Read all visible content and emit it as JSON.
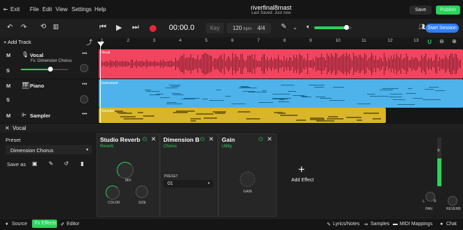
{
  "menubar": {
    "exit": "Exit",
    "file": "File",
    "edit": "Edit",
    "view": "View",
    "settings": "Settings",
    "help": "Help",
    "project_title": "riverfinal8mast",
    "saved_status": "Last Saved: Just now",
    "save": "Save",
    "publish": "Publish"
  },
  "transport": {
    "time": "00:00.0",
    "key": "Key",
    "bpm_value": "120",
    "bpm_unit": "bpm",
    "time_signature": "4/4",
    "start_session": "Start Session",
    "volume_level": 0.85
  },
  "tracks_header": {
    "add_track": "+ Add Track"
  },
  "tracks": [
    {
      "name": "Vocal",
      "fx": "Fx: Dimension Chorus",
      "clip_label": "Vocal",
      "color": "#f2445f",
      "volume": 0.62
    },
    {
      "name": "Piano",
      "fx": "",
      "clip_label": "Instrument",
      "color": "#4db3ea"
    },
    {
      "name": "Sampler",
      "fx": "",
      "clip_label": "Sampler",
      "color": "#d9b52a"
    }
  ],
  "track_buttons": {
    "mute": "M",
    "solo": "S",
    "menu": "•••"
  },
  "ruler": [
    "1",
    "2",
    "3",
    "4",
    "5",
    "6",
    "7",
    "8",
    "9",
    "10",
    "11",
    "12",
    "13"
  ],
  "selected_track": {
    "close": "✕",
    "name": "Vocal"
  },
  "preset_panel": {
    "label": "Preset",
    "value": "Dimension Chorus",
    "save_as": "Save as"
  },
  "effects": [
    {
      "title": "Studio Reverb",
      "type": "Reverb",
      "knobs": {
        "mix": "MIX",
        "color": "COLOR",
        "size": "SIZE"
      }
    },
    {
      "title": "Dimension B",
      "type": "Chorus",
      "preset_label": "PRESET",
      "preset_value": "01"
    },
    {
      "title": "Gain",
      "type": "Utility",
      "knobs": {
        "gain": "GAIN"
      }
    }
  ],
  "add_effect": "Add Effect",
  "channel": {
    "pan": "PAN",
    "reverb": "REVERB",
    "l": "L",
    "r": "R"
  },
  "statusbar": {
    "source": "Source",
    "effects": "Fx Effects",
    "editor": "Editor",
    "lyrics": "Lyrics/Notes",
    "samples": "Samples",
    "midi": "MIDI Mappings",
    "chat": "Chat"
  },
  "colors": {
    "accent_green": "#2ad35a",
    "vocal": "#f2445f",
    "instrument": "#4db3ea",
    "sampler": "#d9b52a",
    "start_session": "#2f7df6"
  }
}
